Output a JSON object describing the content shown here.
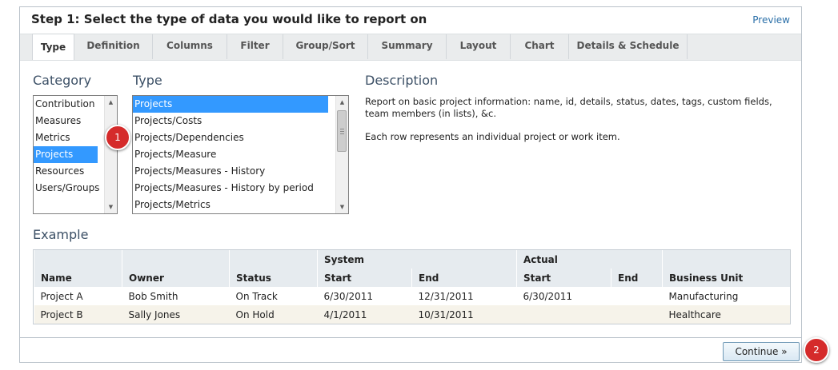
{
  "header": {
    "title": "Step 1: Select the type of data you would like to report on",
    "preview": "Preview"
  },
  "tabs": [
    {
      "label": "Type"
    },
    {
      "label": "Definition"
    },
    {
      "label": "Columns"
    },
    {
      "label": "Filter"
    },
    {
      "label": "Group/Sort"
    },
    {
      "label": "Summary"
    },
    {
      "label": "Layout"
    },
    {
      "label": "Chart"
    },
    {
      "label": "Details & Schedule"
    }
  ],
  "category": {
    "label": "Category",
    "items": [
      "Contribution",
      "Measures",
      "Metrics",
      "Projects",
      "Resources",
      "Users/Groups"
    ],
    "selected": "Projects"
  },
  "type": {
    "label": "Type",
    "items": [
      "Projects",
      "Projects/Costs",
      "Projects/Dependencies",
      "Projects/Measure",
      "Projects/Measures - History",
      "Projects/Measures - History by period",
      "Projects/Metrics"
    ],
    "selected": "Projects"
  },
  "description": {
    "label": "Description",
    "line1": "Report on basic project information: name, id, details, status, dates, tags, custom fields, team members (in lists), &c.",
    "line2": "Each row represents an individual project or work item."
  },
  "example": {
    "label": "Example",
    "group_headers": {
      "system": "System",
      "actual": "Actual"
    },
    "columns": [
      "Name",
      "Owner",
      "Status",
      "Start",
      "End",
      "Start",
      "End",
      "Business Unit"
    ],
    "rows": [
      [
        "Project A",
        "Bob Smith",
        "On Track",
        "6/30/2011",
        "12/31/2011",
        "6/30/2011",
        "",
        "Manufacturing"
      ],
      [
        "Project B",
        "Sally Jones",
        "On Hold",
        "4/1/2011",
        "10/31/2011",
        "",
        "",
        "Healthcare"
      ]
    ]
  },
  "footer": {
    "continue": "Continue »"
  },
  "badges": {
    "one": "1",
    "two": "2"
  },
  "colors": {
    "selection": "#3399ff",
    "badge": "#d52b2b",
    "link": "#2a6fa8"
  }
}
